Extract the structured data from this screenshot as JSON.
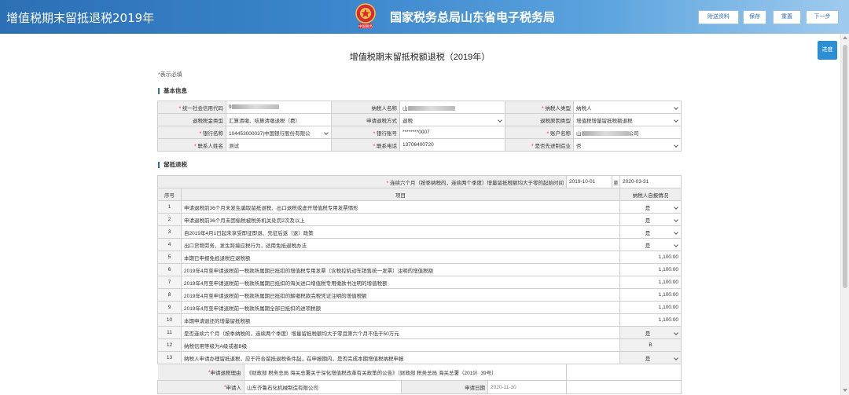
{
  "header": {
    "app_title": "增值税期末留抵退税2019年",
    "bureau_title": "国家税务总局山东省电子税务局",
    "emblem_caption": "中国税务",
    "buttons": [
      "附送资料",
      "保存",
      "重置",
      "下一步"
    ],
    "progress_button": "进度"
  },
  "page": {
    "title": "增值税期末留抵税额退税（2019年）",
    "required_note": "*表示必填"
  },
  "basic_info": {
    "section_title": "基本信息",
    "rows": [
      [
        {
          "label": "统一社会信用代码",
          "required": true,
          "value": "9",
          "masked": true
        },
        {
          "label": "纳税人名称",
          "required": false,
          "value": "山",
          "masked": true
        },
        {
          "label": "纳税人类型",
          "required": true,
          "value": "纳税人",
          "select": true
        }
      ],
      [
        {
          "label": "退税税金类型",
          "required": false,
          "value": "汇算清缴、结算清缴退税（费）"
        },
        {
          "label": "申请退税方式",
          "required": false,
          "value": "退税",
          "select": true
        },
        {
          "label": "退税原因类型",
          "required": false,
          "value": "增值税增量留抵税额退税",
          "select": true
        }
      ],
      [
        {
          "label": "银行名称",
          "required": true,
          "value": "104453000037|中国银行股份有限公",
          "select": true
        },
        {
          "label": "银行账号",
          "required": true,
          "value": "********0007"
        },
        {
          "label": "账户名称",
          "required": true,
          "value": "山",
          "masked": true,
          "suffix": "公司"
        }
      ],
      [
        {
          "label": "联系人姓名",
          "required": true,
          "value": "测试"
        },
        {
          "label": "联系电话",
          "required": true,
          "value": "13706400720"
        },
        {
          "label": "是否先进制造业",
          "required": true,
          "value": "否",
          "select": true
        }
      ]
    ]
  },
  "refund": {
    "section_title": "留抵退税",
    "period_label": "连续六个月（按季纳税的，连续两个季度）增量留抵税额均大于零的起始时间",
    "period_start": "2019-10-01",
    "period_to": "至",
    "period_end": "2020-03-31",
    "col_no": "序号",
    "col_item": "项目",
    "col_status": "纳税人自报情况",
    "items": [
      {
        "no": "1",
        "text": "申请退税前36个月未发生骗取留抵退税、出口退税或虚开增值税专用发票情形",
        "value": "是",
        "select": true
      },
      {
        "no": "2",
        "text": "申请退税前36个月未因偷税被税务机关处罚2次及以上",
        "value": "是",
        "select": true
      },
      {
        "no": "3",
        "text": "自2019年4月1日起未享受即征即退、先征后返（退）政策",
        "value": "是",
        "select": true
      },
      {
        "no": "4",
        "text": "出口货物劳务、发生跨境应税行为，适用免抵退税办法",
        "value": "是",
        "select": true
      },
      {
        "no": "5",
        "text": "本期已申报免抵退税应退税额",
        "value": "1,100.00"
      },
      {
        "no": "6",
        "text": "2019年4月至申请退税前一税款所属期已抵扣的增值税专用发票（含税控机动车销售统一发票）注明的增值税额",
        "value": "1,100.00"
      },
      {
        "no": "7",
        "text": "2019年4月至申请退税前一税款所属期已抵扣的海关进口增值税专用缴款书注明的增值税额",
        "value": "1,100.00"
      },
      {
        "no": "8",
        "text": "2019年4月至申请退税前一税款所属期已抵扣的解缴税款完税凭证注明的增值税额",
        "value": "1,100.00"
      },
      {
        "no": "9",
        "text": "2019年4月至申请退税前一税款所属期全部已抵扣的进项税额",
        "value": "1,100.00"
      },
      {
        "no": "10",
        "text": "本期申请退还的增量留抵税额",
        "value": "1,100.00"
      },
      {
        "no": "11",
        "text": "是否连续六个月（按季纳税的，连续两个季度）增量留抵税额均大于零且第六个月不低于50万元",
        "value": "是",
        "select": true,
        "grey": true
      },
      {
        "no": "12",
        "text": "纳税信用等级为A级或者B级",
        "value": "B",
        "grey": true,
        "center": true
      },
      {
        "no": "13",
        "text": "纳税人申请办理留抵退税，应于符合留抵退税条件起，在申报期内，是否完成本期增值税纳税申报",
        "value": "是",
        "select": true,
        "grey": true
      }
    ],
    "reason_label": "申请退税理由",
    "reason_value": "《财政部 税务总局 海关总署关于深化增值税改革有关政策的公告》〔财政部 税务总局 海关总署（2019）39号〕",
    "applicant_label": "申请人",
    "applicant_value": "山东齐鲁石化机械制造有限公司",
    "date_label": "申请日期",
    "date_value": "2020-11-30"
  },
  "colors": {
    "header_blue": "#2c6fb5",
    "required_red": "#e02020",
    "progress_blue": "#2c8fd6"
  }
}
